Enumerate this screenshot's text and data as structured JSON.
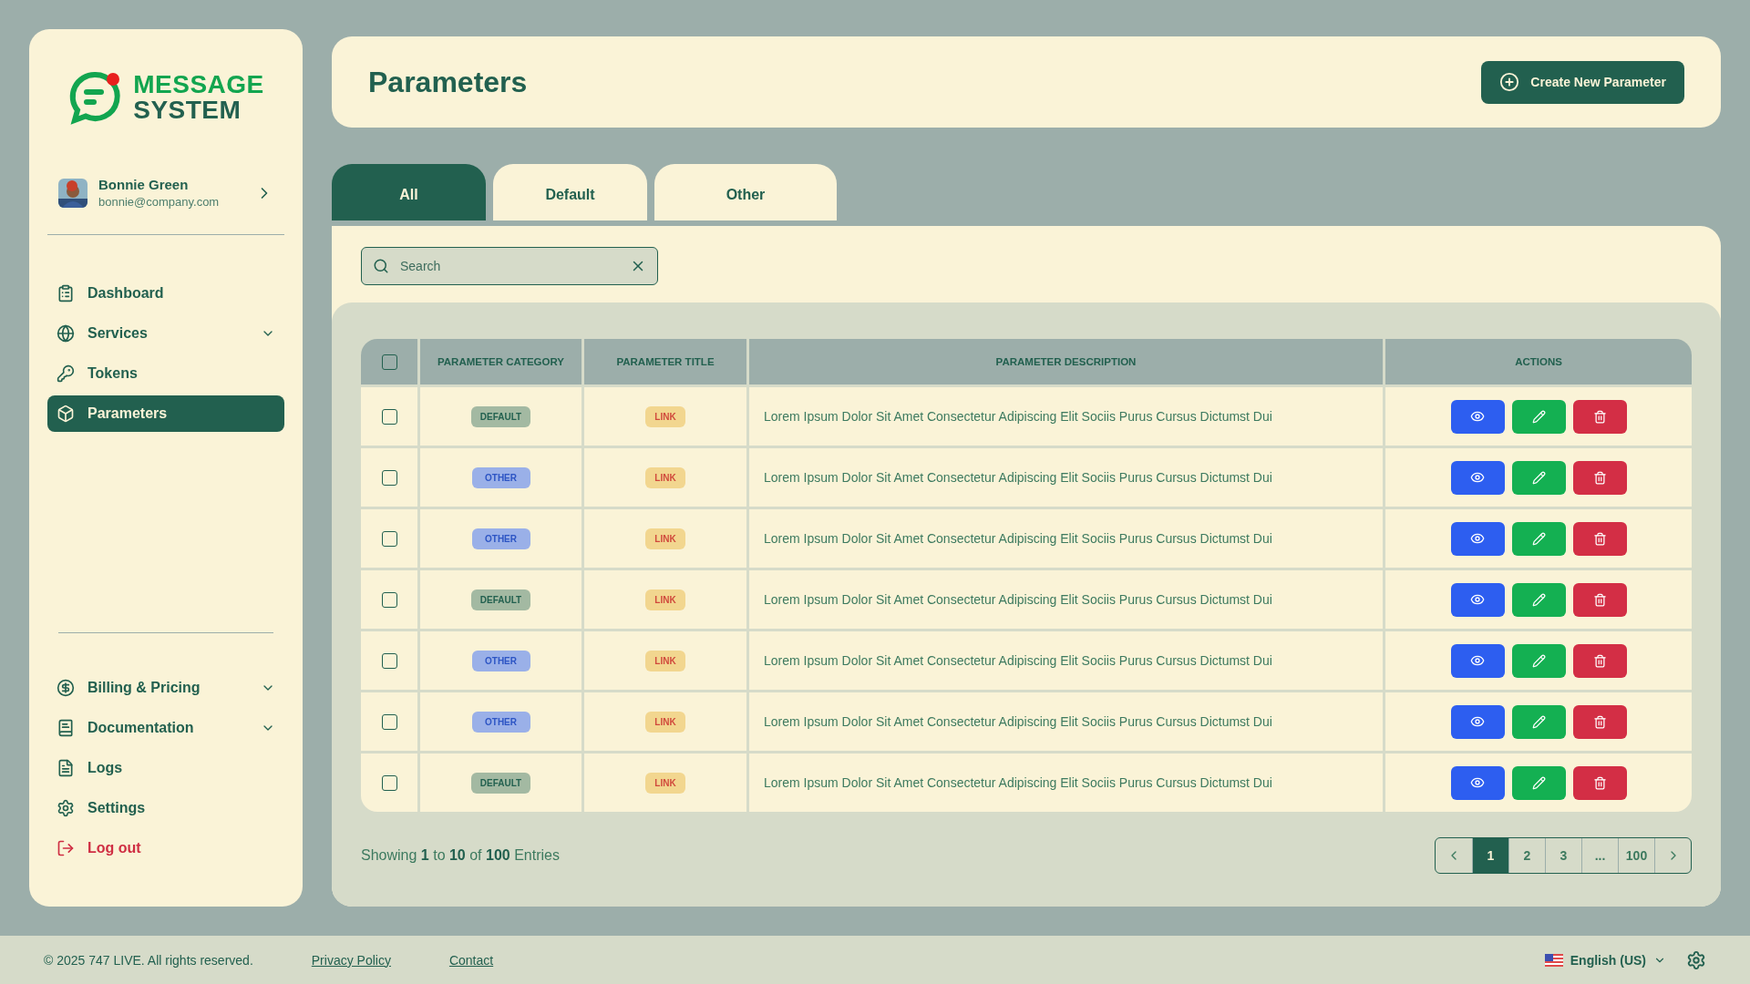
{
  "brand": {
    "line_1": "MESSAGE",
    "line_2": "SYSTEM"
  },
  "user": {
    "name": "Bonnie Green",
    "email": "bonnie@company.com"
  },
  "nav": [
    {
      "label": "Dashboard",
      "expandable": false,
      "selected": false
    },
    {
      "label": "Services",
      "expandable": true,
      "selected": false
    },
    {
      "label": "Tokens",
      "expandable": false,
      "selected": false
    },
    {
      "label": "Parameters",
      "expandable": false,
      "selected": true
    }
  ],
  "nav_bottom": [
    {
      "label": "Billing & Pricing",
      "expandable": true,
      "kind": "normal"
    },
    {
      "label": "Documentation",
      "expandable": true,
      "kind": "normal"
    },
    {
      "label": "Logs",
      "expandable": false,
      "kind": "normal"
    },
    {
      "label": "Settings",
      "expandable": false,
      "kind": "normal"
    },
    {
      "label": "Log out",
      "expandable": false,
      "kind": "danger"
    }
  ],
  "page_title": "Parameters",
  "create_button": "Create New Parameter",
  "tabs": [
    {
      "label": "All",
      "selected": true
    },
    {
      "label": "Default",
      "selected": false
    },
    {
      "label": "Other",
      "selected": false
    }
  ],
  "search": {
    "placeholder": "Search"
  },
  "table": {
    "select_all_checked": false,
    "columns": [
      "PARAMETER CATEGORY",
      "PARAMETER TITLE",
      "PARAMETER DESCRIPTION",
      "ACTIONS"
    ],
    "rows": [
      {
        "checked": false,
        "category": "DEFAULT",
        "kind": "default",
        "title": "LINK",
        "description": "Lorem Ipsum Dolor Sit Amet Consectetur Adipiscing Elit Sociis Purus Cursus Dictumst Dui"
      },
      {
        "checked": false,
        "category": "OTHER",
        "kind": "other",
        "title": "LINK",
        "description": "Lorem Ipsum Dolor Sit Amet Consectetur Adipiscing Elit Sociis Purus Cursus Dictumst Dui"
      },
      {
        "checked": false,
        "category": "OTHER",
        "kind": "other",
        "title": "LINK",
        "description": "Lorem Ipsum Dolor Sit Amet Consectetur Adipiscing Elit Sociis Purus Cursus Dictumst Dui"
      },
      {
        "checked": false,
        "category": "DEFAULT",
        "kind": "default",
        "title": "LINK",
        "description": "Lorem Ipsum Dolor Sit Amet Consectetur Adipiscing Elit Sociis Purus Cursus Dictumst Dui"
      },
      {
        "checked": false,
        "category": "OTHER",
        "kind": "other",
        "title": "LINK",
        "description": "Lorem Ipsum Dolor Sit Amet Consectetur Adipiscing Elit Sociis Purus Cursus Dictumst Dui"
      },
      {
        "checked": false,
        "category": "OTHER",
        "kind": "other",
        "title": "LINK",
        "description": "Lorem Ipsum Dolor Sit Amet Consectetur Adipiscing Elit Sociis Purus Cursus Dictumst Dui"
      },
      {
        "checked": false,
        "category": "DEFAULT",
        "kind": "default",
        "title": "LINK",
        "description": "Lorem Ipsum Dolor Sit Amet Consectetur Adipiscing Elit Sociis Purus Cursus Dictumst Dui"
      }
    ]
  },
  "entries_info": "Showing **1** to **10** of **100** Entries",
  "pagination": [
    {
      "label": "1",
      "selected": true
    },
    {
      "label": "2",
      "selected": false
    },
    {
      "label": "3",
      "selected": false
    },
    {
      "label": "...",
      "selected": false
    },
    {
      "label": "100",
      "selected": false
    }
  ],
  "footer": {
    "copyright": "© 2025 747 LIVE. All rights reserved.",
    "links": [
      "Privacy Policy",
      "Contact"
    ],
    "language": "English (US)"
  }
}
